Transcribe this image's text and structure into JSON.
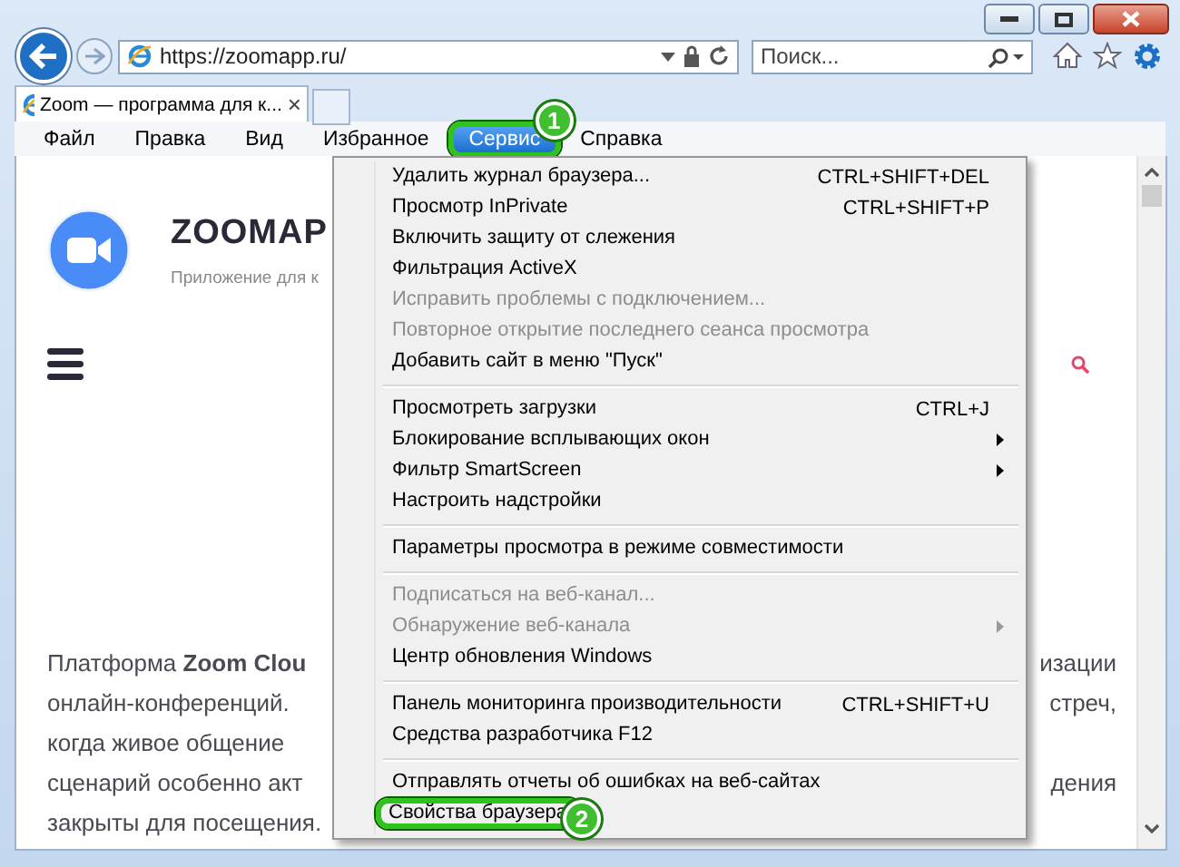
{
  "nav": {
    "address": "https://zoomapp.ru/",
    "search_placeholder": "Поиск..."
  },
  "tabs": [
    {
      "title": "Zoom — программа для к...",
      "close": "×",
      "selected": true
    }
  ],
  "menubar": [
    {
      "label": "Файл",
      "selected": false
    },
    {
      "label": "Правка",
      "selected": false
    },
    {
      "label": "Вид",
      "selected": false
    },
    {
      "label": "Избранное",
      "selected": false
    },
    {
      "label": "Сервис",
      "selected": true,
      "callout": "1"
    },
    {
      "label": "Справка",
      "selected": false
    }
  ],
  "page": {
    "site_title": "ZOOMAP",
    "tagline": "Приложение для к",
    "lines": [
      {
        "left": "Платформа **Zoom Clou**",
        "right": "изации"
      },
      {
        "left": "онлайн-конференций.",
        "right": "стреч,"
      },
      {
        "left": "когда живое общение"
      },
      {
        "left": "сценарий особенно акт",
        "right": "дения"
      },
      {
        "left": "закрыты для посещения."
      }
    ]
  },
  "menu": {
    "groups": [
      {
        "items": [
          {
            "label": "Удалить журнал браузера...",
            "shortcut": "CTRL+SHIFT+DEL",
            "disabled": false
          },
          {
            "label": "Просмотр InPrivate",
            "shortcut": "CTRL+SHIFT+P",
            "disabled": false
          },
          {
            "label": "Включить защиту от слежения",
            "disabled": false
          },
          {
            "label": "Фильтрация ActiveX",
            "disabled": false
          },
          {
            "label": "Исправить проблемы с подключением...",
            "disabled": true
          },
          {
            "label": "Повторное открытие последнего сеанса просмотра",
            "disabled": true
          },
          {
            "label": "Добавить сайт в меню \"Пуск\"",
            "disabled": false
          }
        ]
      },
      {
        "items": [
          {
            "label": "Просмотреть загрузки",
            "shortcut": "CTRL+J",
            "disabled": false
          },
          {
            "label": "Блокирование всплывающих окон",
            "disabled": false,
            "submenu": true
          },
          {
            "label": "Фильтр SmartScreen",
            "disabled": false,
            "submenu": true
          },
          {
            "label": "Настроить надстройки",
            "disabled": false
          }
        ]
      },
      {
        "items": [
          {
            "label": "Параметры просмотра в режиме совместимости",
            "disabled": false
          }
        ]
      },
      {
        "items": [
          {
            "label": "Подписаться на веб-канал...",
            "disabled": true
          },
          {
            "label": "Обнаружение веб-канала",
            "disabled": true,
            "submenu": true
          },
          {
            "label": "Центр обновления Windows",
            "disabled": false
          }
        ]
      },
      {
        "items": [
          {
            "label": "Панель мониторинга производительности",
            "shortcut": "CTRL+SHIFT+U",
            "disabled": false
          },
          {
            "label": "Средства разработчика F12",
            "disabled": false
          }
        ]
      },
      {
        "items": [
          {
            "label": "Отправлять отчеты об ошибках на веб-сайтах",
            "disabled": false
          },
          {
            "label": "Свойства браузера",
            "disabled": false,
            "callout": "2"
          }
        ]
      }
    ]
  }
}
